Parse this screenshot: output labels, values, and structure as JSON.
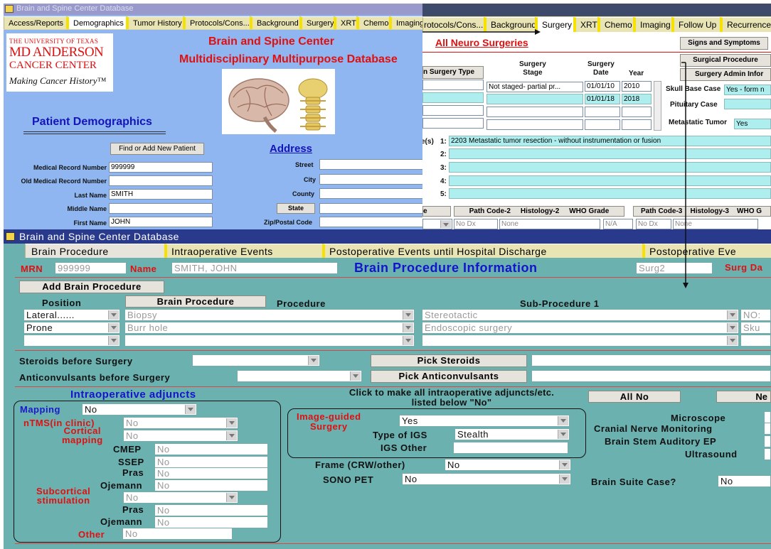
{
  "win1": {
    "title": "Brain and Spine Center Database",
    "tabs": [
      "Access/Reports",
      "Demographics",
      "Tumor History",
      "Protocols/Cons...",
      "Background",
      "Surgery",
      "XRT",
      "Chemo",
      "Imaging"
    ],
    "logo": {
      "line1": "THE UNIVERSITY OF TEXAS",
      "line2": "MD ANDERSON",
      "line3": "CANCER CENTER",
      "tagline": "Making Cancer History™"
    },
    "heading1": "Brain and Spine Center",
    "heading2": "Multidisciplinary Multipurpose Database",
    "section_title": "Patient Demographics",
    "find_button": "Find or Add New Patient",
    "address_title": "Address",
    "fields": [
      {
        "label": "Medical Record Number",
        "value": "999999"
      },
      {
        "label": "Old Medical Record Number",
        "value": ""
      },
      {
        "label": "Last Name",
        "value": "SMITH"
      },
      {
        "label": "Middle Name",
        "value": ""
      },
      {
        "label": "First Name",
        "value": "JOHN"
      }
    ],
    "address": {
      "street": "Street",
      "city": "City",
      "county": "County",
      "state_button": "State",
      "zip": "Zip/Postal Code"
    }
  },
  "win2": {
    "tabs": [
      "rotocols/Cons...",
      "Background",
      "Surgery",
      "XRT",
      "Chemo",
      "Imaging",
      "Follow Up",
      "Recurrence"
    ],
    "all_neuro": "All Neuro Surgeries",
    "signs_button": "Signs and Symptoms",
    "surgical_button": "Surgical Procedure",
    "admin_button": "Surgery Admin Infor",
    "type_button": "n Surgery Type",
    "col_stage": "Surgery\nStage",
    "col_date": "Surgery\nDate",
    "col_year": "Year",
    "rows": [
      {
        "stage": "Not staged- partial pr...",
        "date": "01/01/10",
        "year": "2010"
      },
      {
        "stage": "",
        "date": "01/01/18",
        "year": "2018"
      },
      {
        "stage": "",
        "date": "",
        "year": ""
      },
      {
        "stage": "",
        "date": "",
        "year": ""
      }
    ],
    "skull_label": "Skull Base Case",
    "skull_value": "Yes - form n",
    "pituitary_label": "Pituitary Case",
    "metastatic_label": "Metastatic Tumor",
    "metastatic_value": "Yes",
    "proc_label": "e(s)",
    "procs": [
      {
        "n": "1:",
        "value": "2203    Metastatic tumor resection - without instrumentation or fusion"
      },
      {
        "n": "2:",
        "value": ""
      },
      {
        "n": "3:",
        "value": ""
      },
      {
        "n": "4:",
        "value": ""
      },
      {
        "n": "5:",
        "value": ""
      }
    ],
    "path_headers": [
      "e",
      "Path Code-2",
      "Histology-2",
      "WHO Grade",
      "Path Code-3",
      "Histology-3",
      "WHO G"
    ],
    "path_values": [
      "No Dx",
      "None",
      "N/A",
      "No Dx",
      "None"
    ]
  },
  "win3": {
    "title": "Brain and Spine Center Database",
    "tabs": [
      "Brain Procedure",
      "Intraoperative Events",
      "Postoperative Events until Hospital Discharge",
      "Postoperative Eve"
    ],
    "mrn_label": "MRN",
    "mrn_value": "999999",
    "name_label": "Name",
    "name_value": "SMITH, JOHN",
    "title_main": "Brain Procedure Information",
    "surg_value": "Surg2",
    "surg_label": "Surg Da",
    "add_button": "Add Brain Procedure",
    "position_header": "Position",
    "brain_proc_button": "Brain Procedure",
    "procedure_header": "Procedure",
    "subproc_header": "Sub-Procedure 1",
    "proc_rows": [
      {
        "position": "Lateral......",
        "procedure": "Biopsy",
        "sub": "Stereotactic",
        "extra": "NO:"
      },
      {
        "position": "Prone",
        "procedure": "Burr hole",
        "sub": "Endoscopic surgery",
        "extra": "Sku"
      },
      {
        "position": "",
        "procedure": "",
        "sub": "",
        "extra": ""
      }
    ],
    "steroids_label": "Steroids before Surgery",
    "pick_steroids": "Pick Steroids",
    "anticonv_label": "Anticonvulsants before Surgery",
    "pick_anticonv": "Pick Anticonvulsants",
    "adjuncts_title": "Intraoperative adjuncts",
    "click_note": "Click to make all intraoperative adjuncts/etc. listed below \"No\"",
    "all_no": "All No",
    "ne_button": "Ne",
    "mapping_label": "Mapping",
    "mapping_value": "No",
    "ntms_label": "nTMS(in clinic)",
    "ntms_value": "No",
    "cortical_label": "Cortical\nmapping",
    "cortical_value": "No",
    "cmep_label": "CMEP",
    "cmep_value": "No",
    "ssep_label": "SSEP",
    "ssep_value": "No",
    "pras_label": "Pras",
    "pras_value": "No",
    "ojemann_label": "Ojemann",
    "ojemann_value": "No",
    "subcort_label": "Subcortical\nstimulation",
    "subcort_value": "No",
    "pras2_label": "Pras",
    "pras2_value": "No",
    "ojemann2_label": "Ojemann",
    "ojemann2_value": "No",
    "other_label": "Other",
    "other_value": "No",
    "igs_label": "Image-guided\nSurgery",
    "igs_value": "Yes",
    "igs_type_label": "Type of IGS",
    "igs_type_value": "Stealth",
    "igs_other_label": "IGS Other",
    "igs_other_value": "",
    "frame_label": "Frame (CRW/other)",
    "frame_value": "No",
    "sono_label": "SONO PET",
    "sono_value": "No",
    "microscope_label": "Microscope",
    "cranial_label": "Cranial Nerve Monitoring",
    "brainstem_label": "Brain Stem Auditory EP",
    "ultrasound_label": "Ultrasound",
    "suite_label": "Brain Suite Case?",
    "suite_value": "No"
  }
}
